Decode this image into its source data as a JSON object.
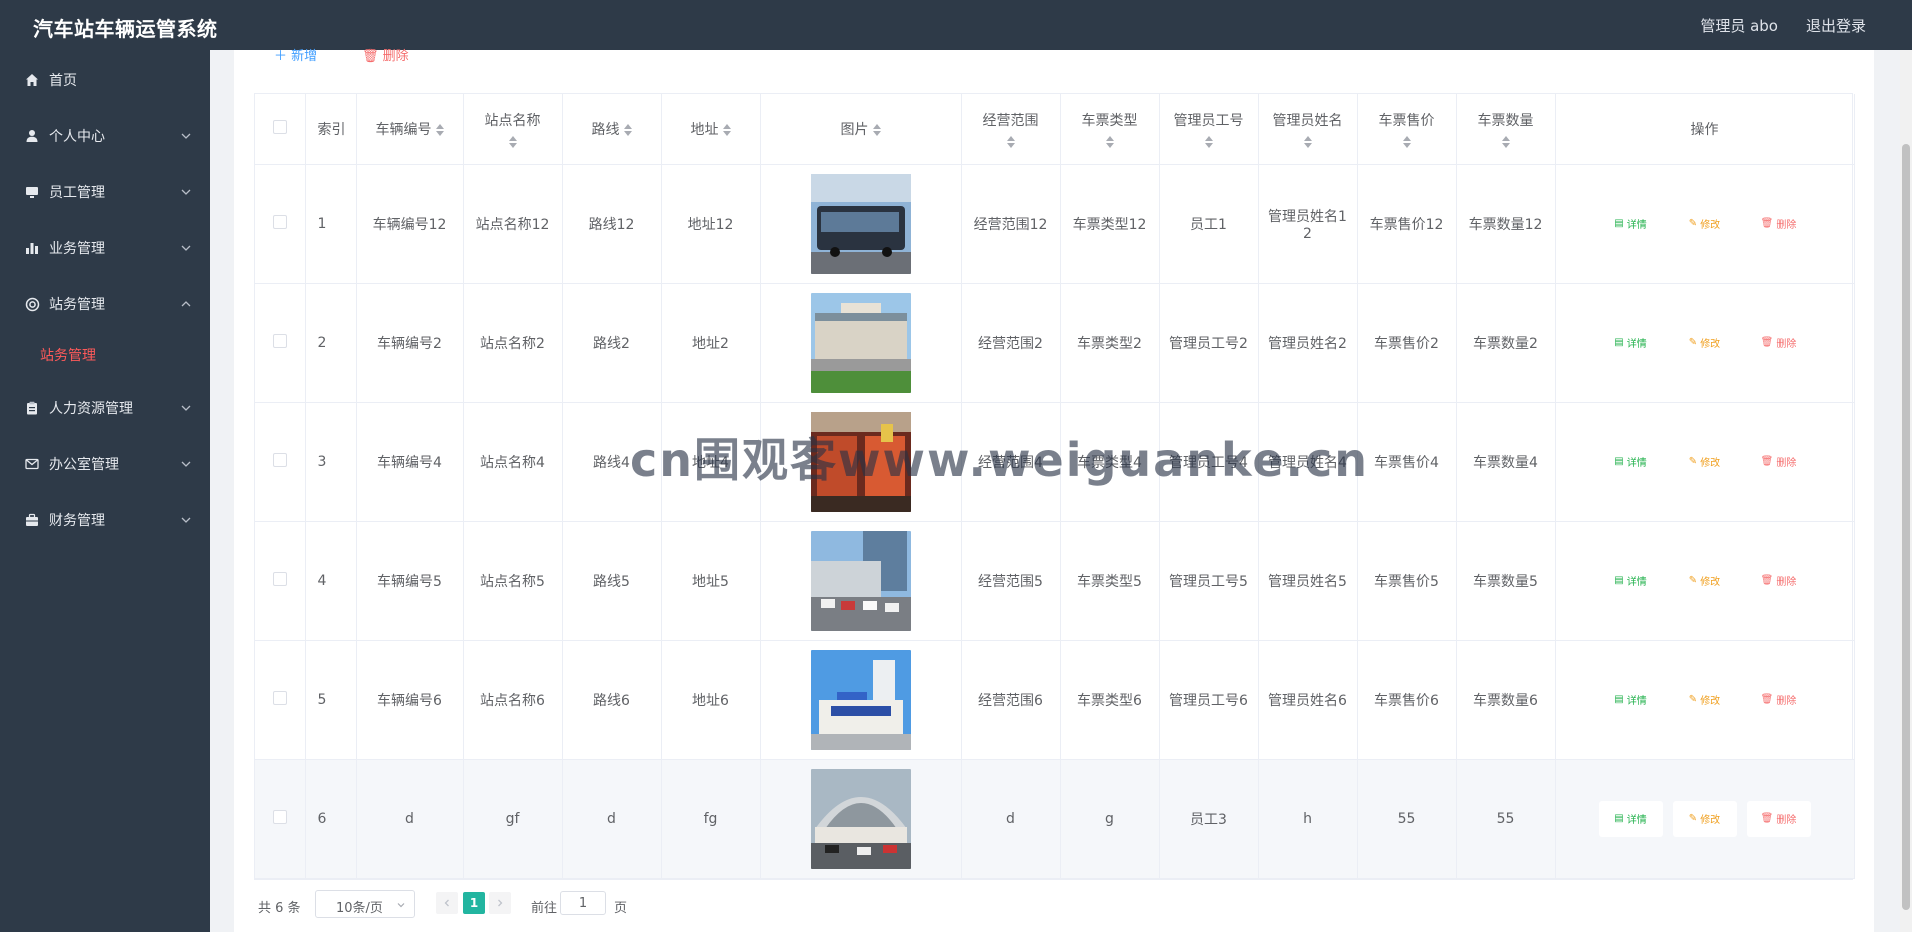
{
  "header": {
    "title": "汽车站车辆运管系统",
    "user": "管理员 abo",
    "logout": "退出登录"
  },
  "sidebar": {
    "items": [
      {
        "label": "首页",
        "icon": "home-icon",
        "expanded": null
      },
      {
        "label": "个人中心",
        "icon": "user-icon",
        "expanded": false
      },
      {
        "label": "员工管理",
        "icon": "monitor-icon",
        "expanded": false
      },
      {
        "label": "业务管理",
        "icon": "bar-chart-icon",
        "expanded": false
      },
      {
        "label": "站务管理",
        "icon": "lifebuoy-icon",
        "expanded": true
      },
      {
        "label": "人力资源管理",
        "icon": "clipboard-icon",
        "expanded": false
      },
      {
        "label": "办公室管理",
        "icon": "mail-icon",
        "expanded": false
      },
      {
        "label": "财务管理",
        "icon": "briefcase-icon",
        "expanded": false
      }
    ],
    "active_submenu": "站务管理"
  },
  "toolbar": {
    "add_label": "新增",
    "delete_label": "删除"
  },
  "table": {
    "columns": [
      "索引",
      "车辆编号",
      "站点名称",
      "路线",
      "地址",
      "图片",
      "经营范围",
      "车票类型",
      "管理员工号",
      "管理员姓名",
      "车票售价",
      "车票数量",
      "操作"
    ],
    "rows": [
      {
        "index": "1",
        "vehicle_no": "车辆编号12",
        "station": "站点名称12",
        "route": "路线12",
        "address": "地址12",
        "scope": "经营范围12",
        "ticket_type": "车票类型12",
        "staff_no": "员工1",
        "admin_name": "管理员姓名12",
        "price": "车票售价12",
        "quantity": "车票数量12"
      },
      {
        "index": "2",
        "vehicle_no": "车辆编号2",
        "station": "站点名称2",
        "route": "路线2",
        "address": "地址2",
        "scope": "经营范围2",
        "ticket_type": "车票类型2",
        "staff_no": "管理员工号2",
        "admin_name": "管理员姓名2",
        "price": "车票售价2",
        "quantity": "车票数量2"
      },
      {
        "index": "3",
        "vehicle_no": "车辆编号4",
        "station": "站点名称4",
        "route": "路线4",
        "address": "地址4",
        "scope": "经营范围4",
        "ticket_type": "车票类型4",
        "staff_no": "管理员工号4",
        "admin_name": "管理员姓名4",
        "price": "车票售价4",
        "quantity": "车票数量4"
      },
      {
        "index": "4",
        "vehicle_no": "车辆编号5",
        "station": "站点名称5",
        "route": "路线5",
        "address": "地址5",
        "scope": "经营范围5",
        "ticket_type": "车票类型5",
        "staff_no": "管理员工号5",
        "admin_name": "管理员姓名5",
        "price": "车票售价5",
        "quantity": "车票数量5"
      },
      {
        "index": "5",
        "vehicle_no": "车辆编号6",
        "station": "站点名称6",
        "route": "路线6",
        "address": "地址6",
        "scope": "经营范围6",
        "ticket_type": "车票类型6",
        "staff_no": "管理员工号6",
        "admin_name": "管理员姓名6",
        "price": "车票售价6",
        "quantity": "车票数量6"
      },
      {
        "index": "6",
        "vehicle_no": "d",
        "station": "gf",
        "route": "d",
        "address": "fg",
        "scope": "d",
        "ticket_type": "g",
        "staff_no": "员工3",
        "admin_name": "h",
        "price": "55",
        "quantity": "55"
      }
    ],
    "actions": {
      "detail": "详情",
      "edit": "修改",
      "delete": "删除"
    }
  },
  "pagination": {
    "total": "共 6 条",
    "page_size": "10条/页",
    "current_page": "1",
    "goto_label": "前往",
    "goto_value": "1",
    "page_label": "页"
  },
  "watermark": "cn围观客www.weiguanke.cn",
  "colors": {
    "sidebar_bg": "#2e3a48",
    "active_submenu": "#ff5a5a",
    "primary": "#409eff",
    "danger": "#f56c6c",
    "success": "#22b14c",
    "warning": "#f0a020",
    "page_active": "#22b5a0"
  }
}
